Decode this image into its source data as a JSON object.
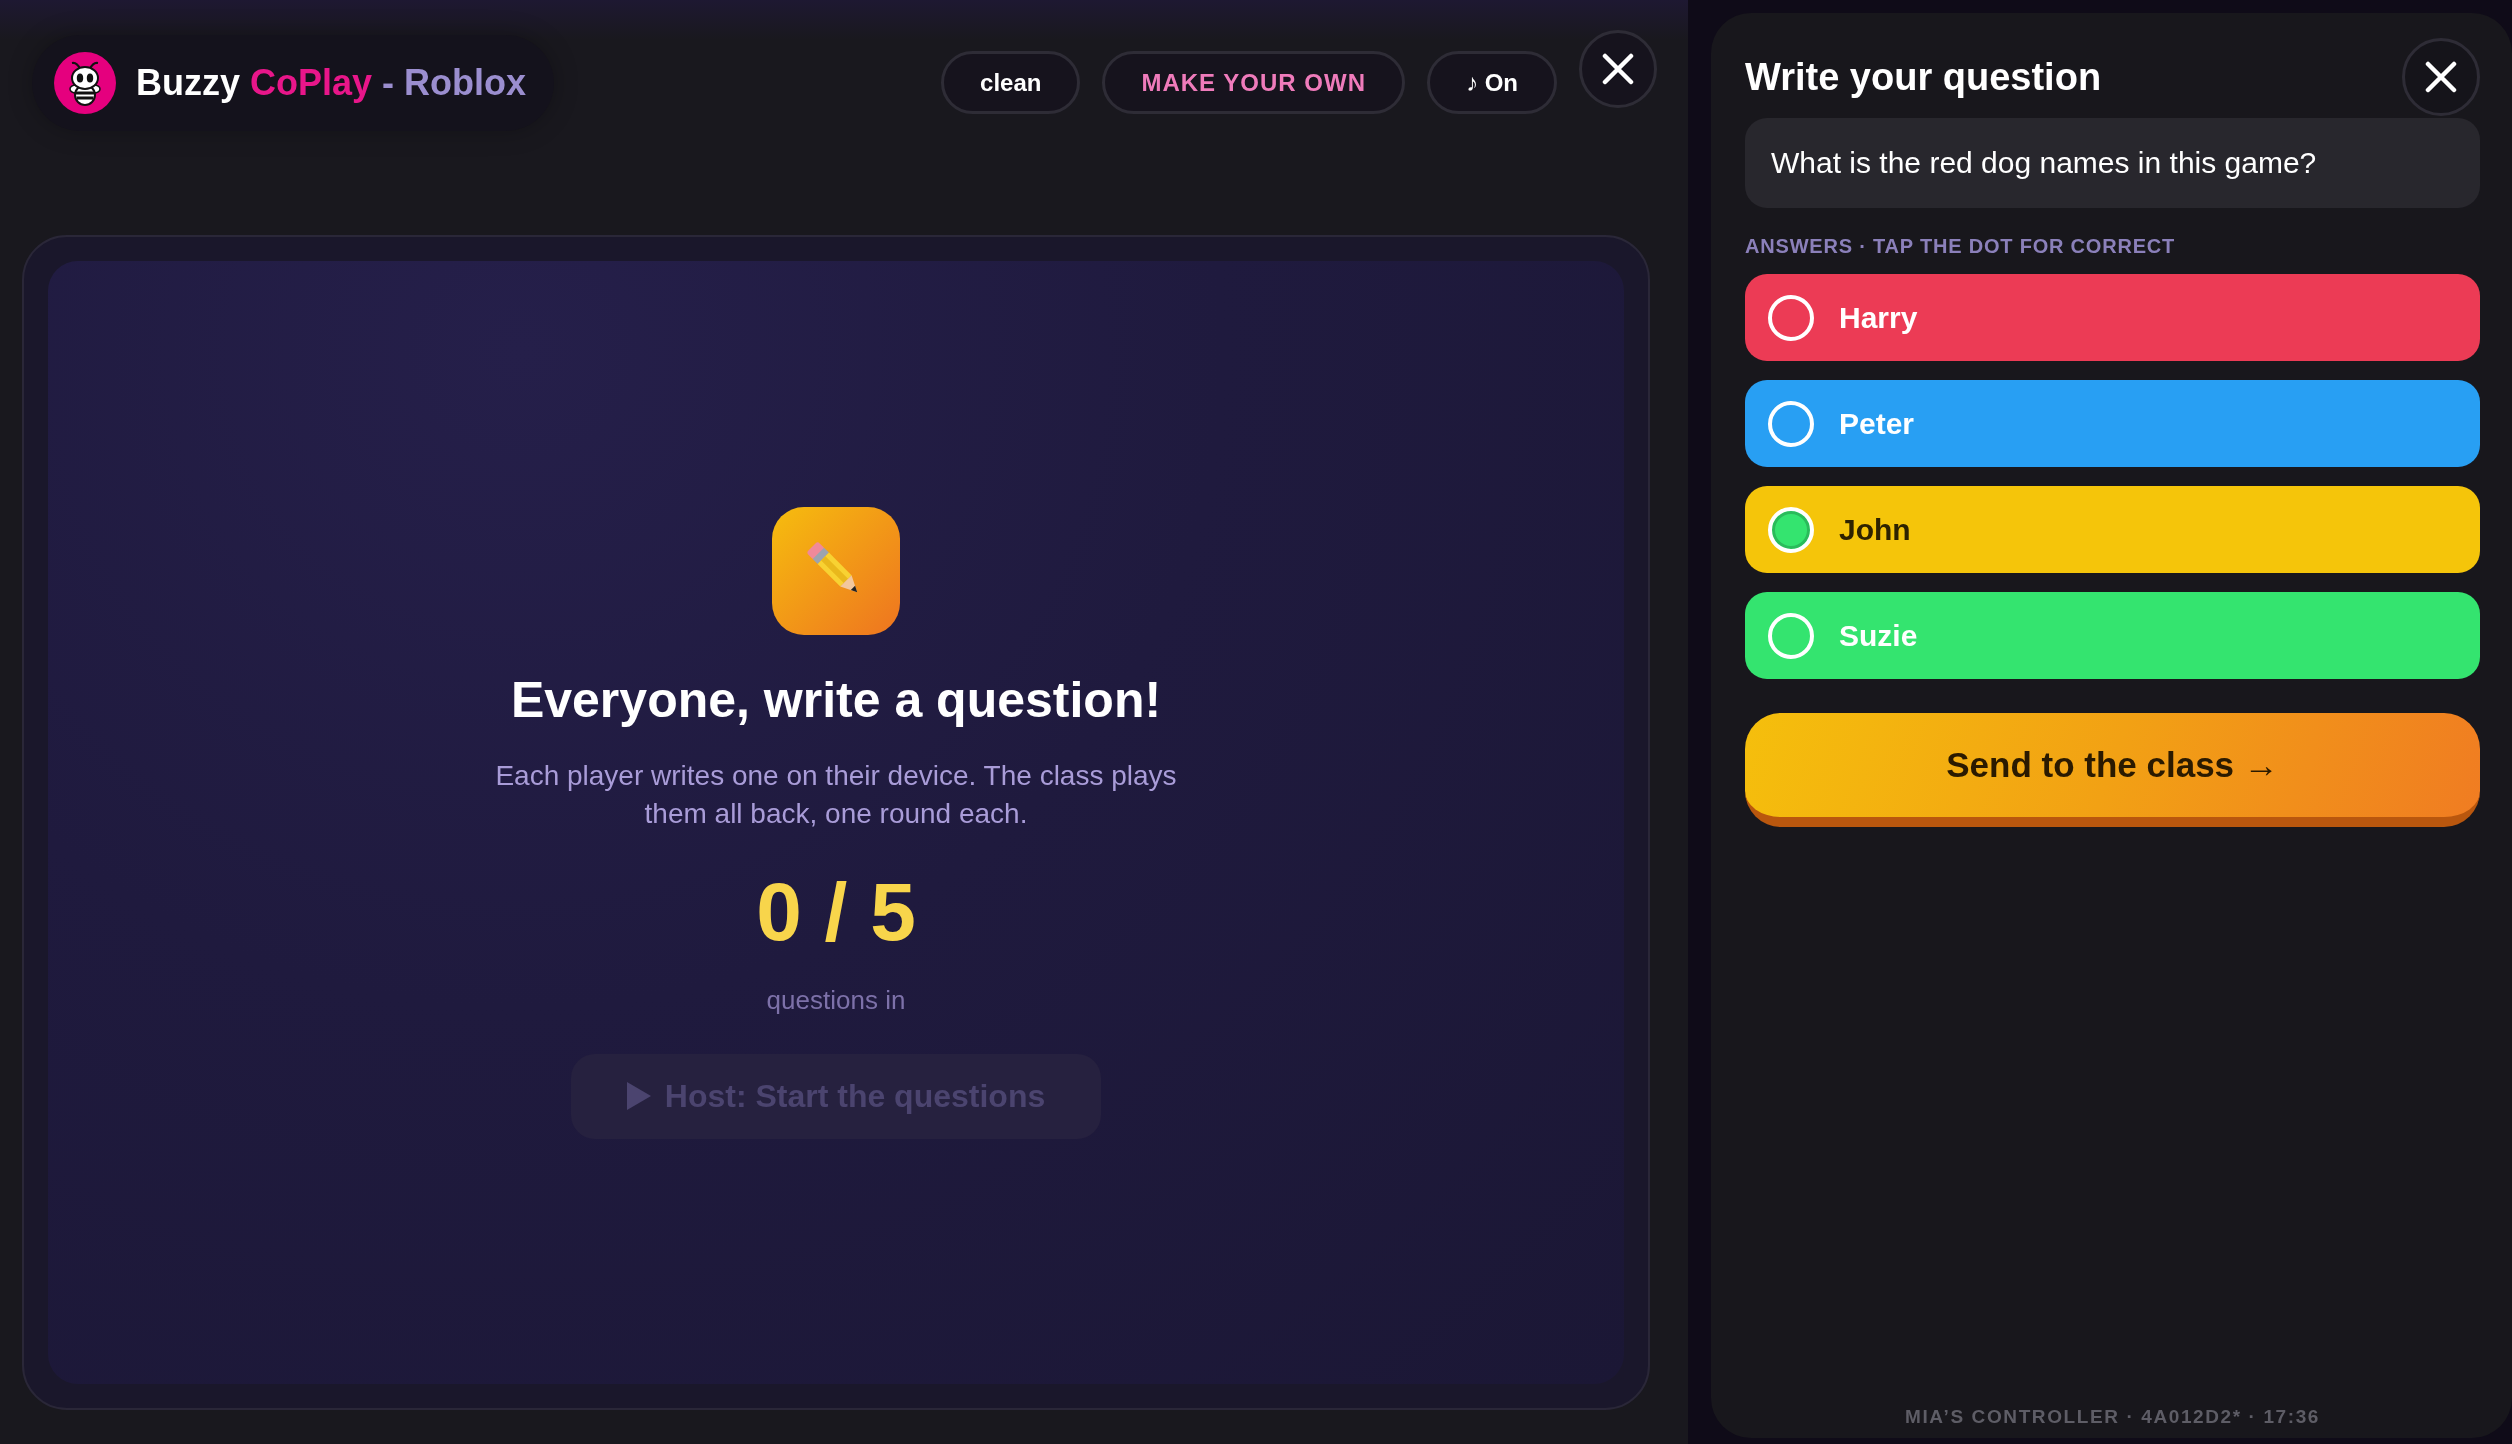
{
  "header": {
    "brand": {
      "name": "Buzzy",
      "highlight": "CoPlay",
      "suffix": "- Roblox"
    },
    "buttons": [
      {
        "label": "clean",
        "kind": "plain"
      },
      {
        "label": "MAKE YOUR OWN",
        "kind": "accent"
      },
      {
        "label": "♪ On",
        "kind": "plain"
      }
    ]
  },
  "stage": {
    "title": "Everyone, write a question!",
    "description": "Each player writes one on their device. The class plays them all back, one round each.",
    "count": "0 / 5",
    "count_label": "questions in",
    "start_button": {
      "label": "Host: Start the questions",
      "disabled": true
    }
  },
  "editor": {
    "title": "Write your question",
    "question": {
      "value": "What is the red dog names in this game?"
    },
    "answers_label": "ANSWERS · TAP THE DOT FOR CORRECT",
    "answers": [
      {
        "text": "Harry",
        "color": "#ec3b55",
        "selected": false
      },
      {
        "text": "Peter",
        "color": "#289ff3",
        "selected": false
      },
      {
        "text": "John",
        "color": "#f5c50a",
        "selected": true
      },
      {
        "text": "Suzie",
        "color": "#34e46f",
        "selected": false
      }
    ],
    "send_button": {
      "label": "Send to the class →"
    },
    "footer": "MIA’S CONTROLLER · 4A012D2* · 17:36"
  }
}
